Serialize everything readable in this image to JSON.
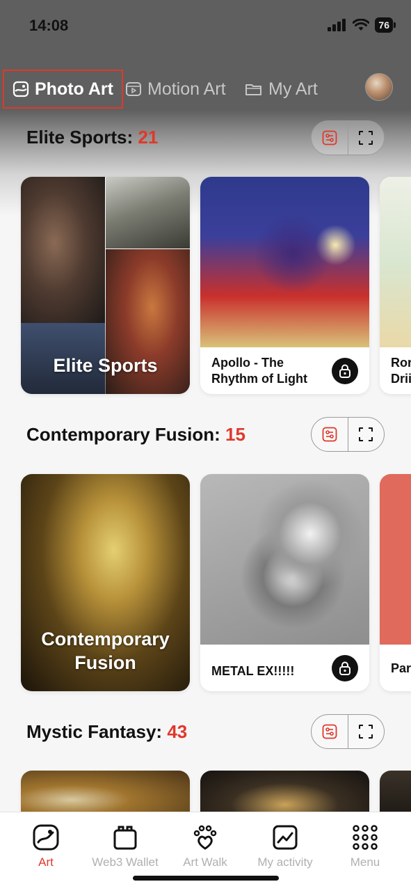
{
  "status_bar": {
    "time": "14:08",
    "battery": "76"
  },
  "tabs": [
    {
      "label": "Photo Art",
      "icon": "photo-icon",
      "active": true
    },
    {
      "label": "Motion Art",
      "icon": "play-icon",
      "active": false
    },
    {
      "label": "My Art",
      "icon": "folder-icon",
      "active": false
    }
  ],
  "sections": [
    {
      "title": "Elite Sports:",
      "count": "21",
      "category_label": "Elite Sports",
      "cards": [
        {
          "title": "Apollo - The Rhythm of Light",
          "locked": true
        }
      ],
      "peek_label": "Ror Drii"
    },
    {
      "title": "Contemporary Fusion:",
      "count": "15",
      "category_label": "Contemporary Fusion",
      "cards": [
        {
          "title": "METAL EX!!!!!",
          "locked": true
        }
      ],
      "peek_label": "Par"
    },
    {
      "title": "Mystic Fantasy:",
      "count": "43"
    }
  ],
  "bottom_nav": [
    {
      "label": "Art",
      "icon": "art-palette-icon",
      "active": true
    },
    {
      "label": "Web3 Wallet",
      "icon": "wallet-icon",
      "active": false
    },
    {
      "label": "Art Walk",
      "icon": "paw-icon",
      "active": false
    },
    {
      "label": "My activity",
      "icon": "chart-icon",
      "active": false
    },
    {
      "label": "Menu",
      "icon": "grid-icon",
      "active": false
    }
  ],
  "colors": {
    "accent": "#e0382b",
    "header_bg": "#5f5f5f",
    "inactive_text": "#b0b0b0"
  }
}
